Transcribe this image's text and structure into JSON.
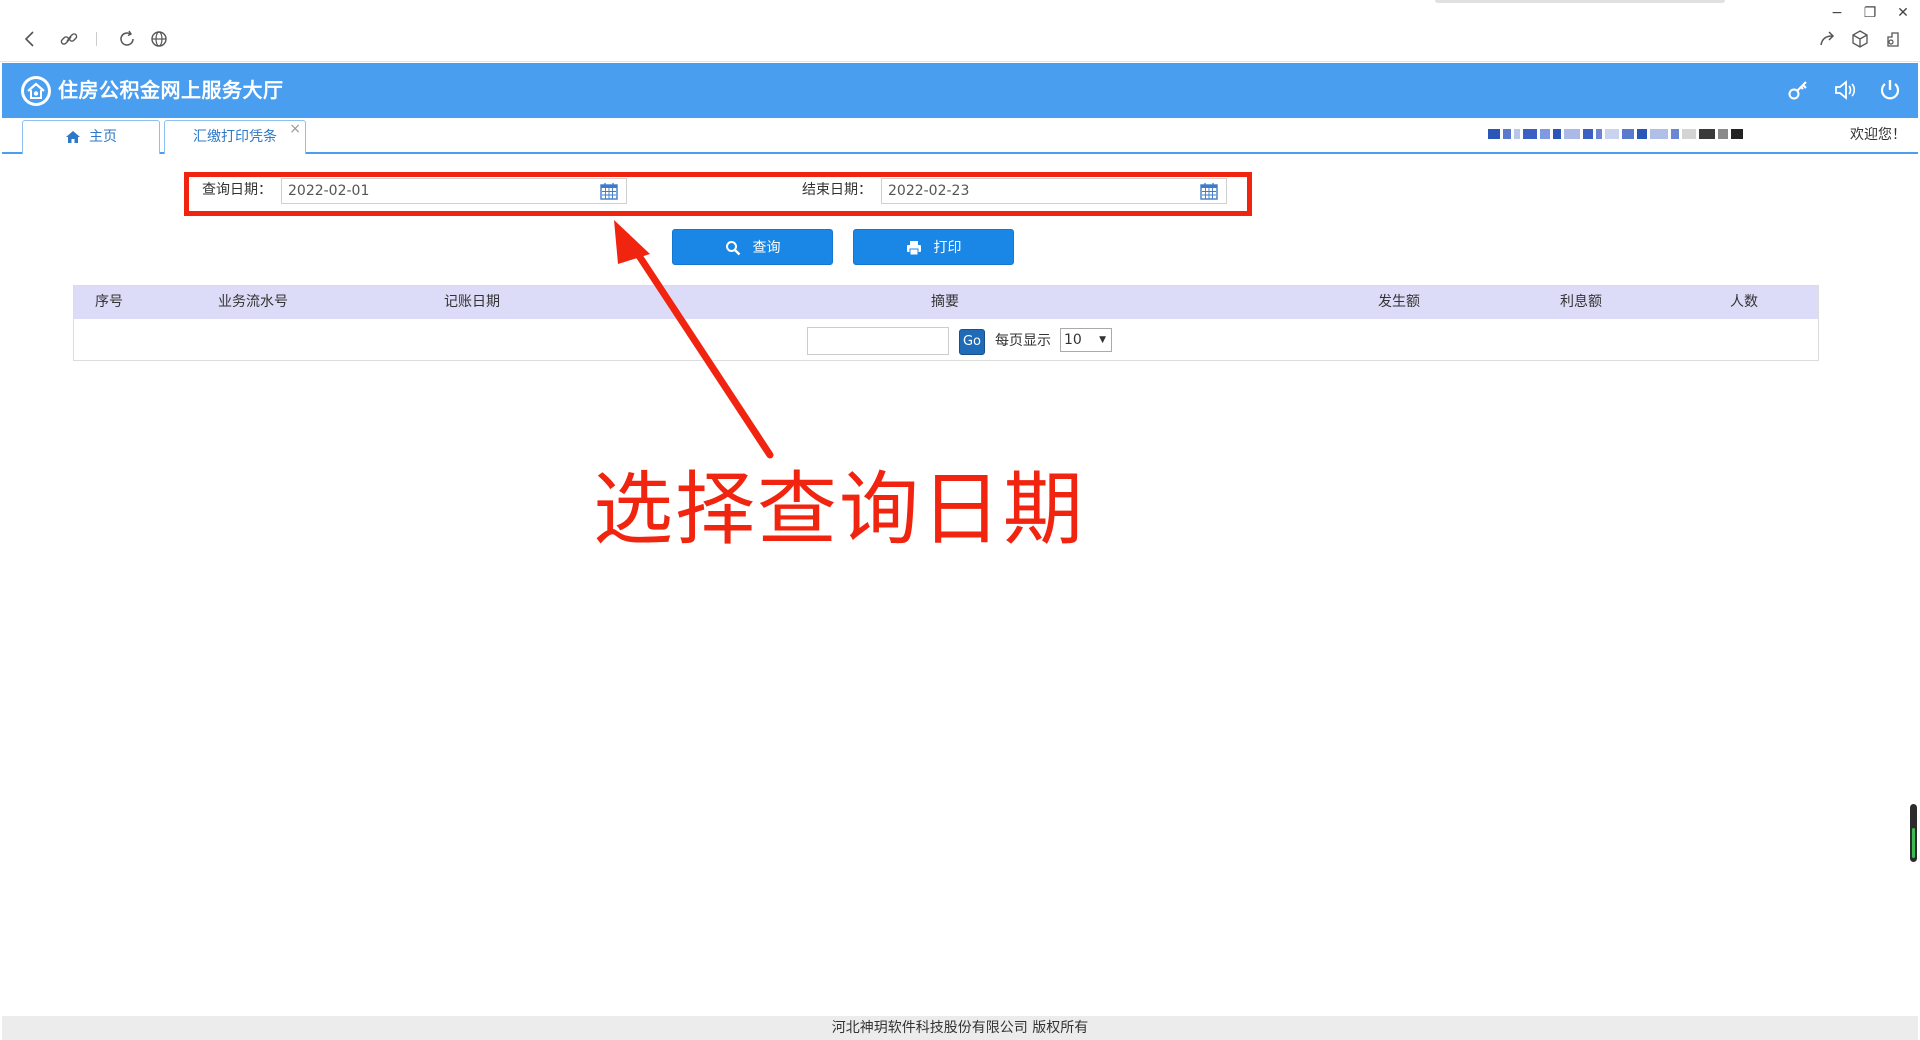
{
  "colors": {
    "header_bg": "#4a9ef0",
    "button_bg": "#1a87e6",
    "annotation": "#f0240f",
    "table_head_bg": "#dcdcf8",
    "go_button_bg": "#1f6bb8"
  },
  "browser": {
    "icons": [
      "back-icon",
      "link-icon",
      "reload-icon",
      "globe-icon",
      "share-icon",
      "cube-icon",
      "extension-icon"
    ],
    "window_controls": [
      "−",
      "❐",
      "✕"
    ]
  },
  "app": {
    "title": "住房公积金网上服务大厅",
    "header_icons": [
      "key-icon",
      "speaker-icon",
      "power-icon"
    ]
  },
  "tabs": [
    {
      "label": "主页",
      "icon": "home-icon"
    },
    {
      "label": "汇缴打印凭条",
      "close": "×"
    }
  ],
  "welcome": "欢迎您！",
  "form": {
    "start_label": "查询日期：",
    "start_value": "2022-02-01",
    "end_label": "结束日期：",
    "end_value": "2022-02-23"
  },
  "buttons": {
    "query": "查询",
    "print": "打印"
  },
  "table": {
    "columns": [
      "序号",
      "业务流水号",
      "记账日期",
      "摘要",
      "发生额",
      "利息额",
      "人数"
    ],
    "rows": []
  },
  "pager": {
    "page_value": "",
    "go": "Go",
    "per_page_label": "每页显示",
    "per_page_value": "10"
  },
  "annotation": {
    "text": "选择查询日期"
  },
  "footer": "河北神玥软件科技股份有限公司 版权所有"
}
